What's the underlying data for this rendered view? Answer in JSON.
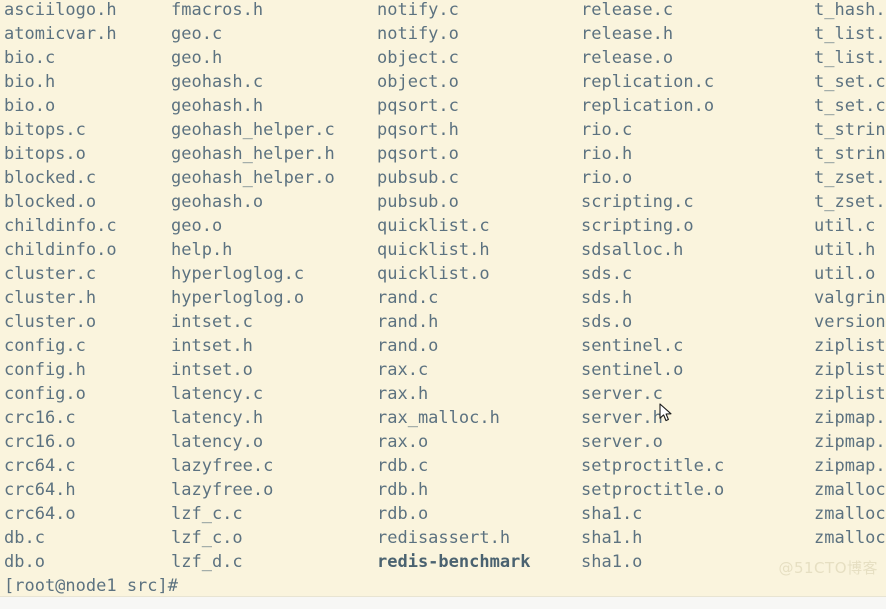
{
  "terminal": {
    "background_color": "#faf4dd",
    "text_color": "#5c7280",
    "executable_color": "#4a6270",
    "prompt": "[root@node1 src]#",
    "command_output_type": "ls",
    "columns": [
      {
        "index": 0,
        "entries": [
          {
            "name": "asciilogo.h",
            "kind": "file"
          },
          {
            "name": "atomicvar.h",
            "kind": "file"
          },
          {
            "name": "bio.c",
            "kind": "file"
          },
          {
            "name": "bio.h",
            "kind": "file"
          },
          {
            "name": "bio.o",
            "kind": "file"
          },
          {
            "name": "bitops.c",
            "kind": "file"
          },
          {
            "name": "bitops.o",
            "kind": "file"
          },
          {
            "name": "blocked.c",
            "kind": "file"
          },
          {
            "name": "blocked.o",
            "kind": "file"
          },
          {
            "name": "childinfo.c",
            "kind": "file"
          },
          {
            "name": "childinfo.o",
            "kind": "file"
          },
          {
            "name": "cluster.c",
            "kind": "file"
          },
          {
            "name": "cluster.h",
            "kind": "file"
          },
          {
            "name": "cluster.o",
            "kind": "file"
          },
          {
            "name": "config.c",
            "kind": "file"
          },
          {
            "name": "config.h",
            "kind": "file"
          },
          {
            "name": "config.o",
            "kind": "file"
          },
          {
            "name": "crc16.c",
            "kind": "file"
          },
          {
            "name": "crc16.o",
            "kind": "file"
          },
          {
            "name": "crc64.c",
            "kind": "file"
          },
          {
            "name": "crc64.h",
            "kind": "file"
          },
          {
            "name": "crc64.o",
            "kind": "file"
          },
          {
            "name": "db.c",
            "kind": "file"
          },
          {
            "name": "db.o",
            "kind": "file"
          }
        ]
      },
      {
        "index": 1,
        "entries": [
          {
            "name": "fmacros.h",
            "kind": "file"
          },
          {
            "name": "geo.c",
            "kind": "file"
          },
          {
            "name": "geo.h",
            "kind": "file"
          },
          {
            "name": "geohash.c",
            "kind": "file"
          },
          {
            "name": "geohash.h",
            "kind": "file"
          },
          {
            "name": "geohash_helper.c",
            "kind": "file"
          },
          {
            "name": "geohash_helper.h",
            "kind": "file"
          },
          {
            "name": "geohash_helper.o",
            "kind": "file"
          },
          {
            "name": "geohash.o",
            "kind": "file"
          },
          {
            "name": "geo.o",
            "kind": "file"
          },
          {
            "name": "help.h",
            "kind": "file"
          },
          {
            "name": "hyperloglog.c",
            "kind": "file"
          },
          {
            "name": "hyperloglog.o",
            "kind": "file"
          },
          {
            "name": "intset.c",
            "kind": "file"
          },
          {
            "name": "intset.h",
            "kind": "file"
          },
          {
            "name": "intset.o",
            "kind": "file"
          },
          {
            "name": "latency.c",
            "kind": "file"
          },
          {
            "name": "latency.h",
            "kind": "file"
          },
          {
            "name": "latency.o",
            "kind": "file"
          },
          {
            "name": "lazyfree.c",
            "kind": "file"
          },
          {
            "name": "lazyfree.o",
            "kind": "file"
          },
          {
            "name": "lzf_c.c",
            "kind": "file"
          },
          {
            "name": "lzf_c.o",
            "kind": "file"
          },
          {
            "name": "lzf_d.c",
            "kind": "file"
          }
        ]
      },
      {
        "index": 2,
        "entries": [
          {
            "name": "notify.c",
            "kind": "file"
          },
          {
            "name": "notify.o",
            "kind": "file"
          },
          {
            "name": "object.c",
            "kind": "file"
          },
          {
            "name": "object.o",
            "kind": "file"
          },
          {
            "name": "pqsort.c",
            "kind": "file"
          },
          {
            "name": "pqsort.h",
            "kind": "file"
          },
          {
            "name": "pqsort.o",
            "kind": "file"
          },
          {
            "name": "pubsub.c",
            "kind": "file"
          },
          {
            "name": "pubsub.o",
            "kind": "file"
          },
          {
            "name": "quicklist.c",
            "kind": "file"
          },
          {
            "name": "quicklist.h",
            "kind": "file"
          },
          {
            "name": "quicklist.o",
            "kind": "file"
          },
          {
            "name": "rand.c",
            "kind": "file"
          },
          {
            "name": "rand.h",
            "kind": "file"
          },
          {
            "name": "rand.o",
            "kind": "file"
          },
          {
            "name": "rax.c",
            "kind": "file"
          },
          {
            "name": "rax.h",
            "kind": "file"
          },
          {
            "name": "rax_malloc.h",
            "kind": "file"
          },
          {
            "name": "rax.o",
            "kind": "file"
          },
          {
            "name": "rdb.c",
            "kind": "file"
          },
          {
            "name": "rdb.h",
            "kind": "file"
          },
          {
            "name": "rdb.o",
            "kind": "file"
          },
          {
            "name": "redisassert.h",
            "kind": "file"
          },
          {
            "name": "redis-benchmark",
            "kind": "executable"
          }
        ]
      },
      {
        "index": 3,
        "entries": [
          {
            "name": "release.c",
            "kind": "file"
          },
          {
            "name": "release.h",
            "kind": "file"
          },
          {
            "name": "release.o",
            "kind": "file"
          },
          {
            "name": "replication.c",
            "kind": "file"
          },
          {
            "name": "replication.o",
            "kind": "file"
          },
          {
            "name": "rio.c",
            "kind": "file"
          },
          {
            "name": "rio.h",
            "kind": "file"
          },
          {
            "name": "rio.o",
            "kind": "file"
          },
          {
            "name": "scripting.c",
            "kind": "file"
          },
          {
            "name": "scripting.o",
            "kind": "file"
          },
          {
            "name": "sdsalloc.h",
            "kind": "file"
          },
          {
            "name": "sds.c",
            "kind": "file"
          },
          {
            "name": "sds.h",
            "kind": "file"
          },
          {
            "name": "sds.o",
            "kind": "file"
          },
          {
            "name": "sentinel.c",
            "kind": "file"
          },
          {
            "name": "sentinel.o",
            "kind": "file"
          },
          {
            "name": "server.c",
            "kind": "file"
          },
          {
            "name": "server.h",
            "kind": "file"
          },
          {
            "name": "server.o",
            "kind": "file"
          },
          {
            "name": "setproctitle.c",
            "kind": "file"
          },
          {
            "name": "setproctitle.o",
            "kind": "file"
          },
          {
            "name": "sha1.c",
            "kind": "file"
          },
          {
            "name": "sha1.h",
            "kind": "file"
          },
          {
            "name": "sha1.o",
            "kind": "file"
          }
        ]
      },
      {
        "index": 4,
        "entries": [
          {
            "name": "t_hash.",
            "kind": "file"
          },
          {
            "name": "t_list.",
            "kind": "file"
          },
          {
            "name": "t_list.",
            "kind": "file"
          },
          {
            "name": "t_set.c",
            "kind": "file"
          },
          {
            "name": "t_set.c",
            "kind": "file"
          },
          {
            "name": "t_strin",
            "kind": "file"
          },
          {
            "name": "t_strin",
            "kind": "file"
          },
          {
            "name": "t_zset.",
            "kind": "file"
          },
          {
            "name": "t_zset.",
            "kind": "file"
          },
          {
            "name": "util.c",
            "kind": "file"
          },
          {
            "name": "util.h",
            "kind": "file"
          },
          {
            "name": "util.o",
            "kind": "file"
          },
          {
            "name": "valgrin",
            "kind": "file"
          },
          {
            "name": "version",
            "kind": "file"
          },
          {
            "name": "ziplist",
            "kind": "file"
          },
          {
            "name": "ziplist",
            "kind": "file"
          },
          {
            "name": "ziplist",
            "kind": "file"
          },
          {
            "name": "zipmap.",
            "kind": "file"
          },
          {
            "name": "zipmap.",
            "kind": "file"
          },
          {
            "name": "zipmap.",
            "kind": "file"
          },
          {
            "name": "zmalloc",
            "kind": "file"
          },
          {
            "name": "zmalloc",
            "kind": "file"
          },
          {
            "name": "zmalloc",
            "kind": "file"
          }
        ]
      }
    ]
  },
  "watermark": {
    "text": "@51CTO博客"
  }
}
